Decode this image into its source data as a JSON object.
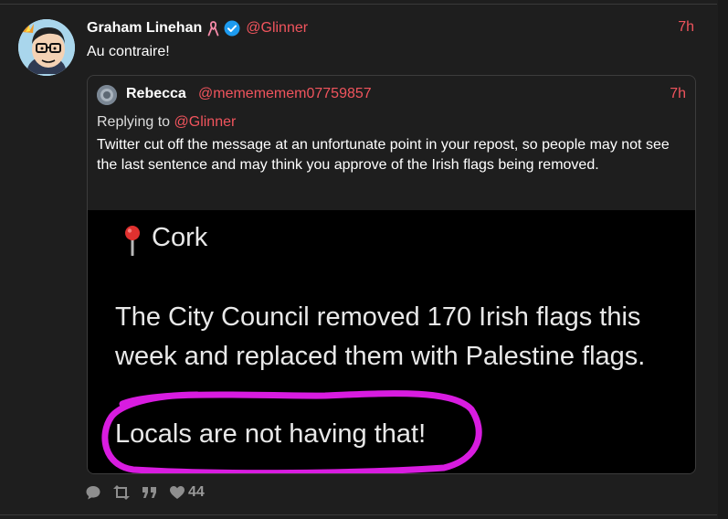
{
  "tweet": {
    "author_name": "Graham Linehan",
    "author_handle": "@Glinner",
    "timestamp": "7h",
    "text": "Au contraire!",
    "icons": [
      "ribbon-icon",
      "verified-icon"
    ]
  },
  "quote": {
    "author_name": "Rebecca",
    "author_handle": "@memememem07759857",
    "timestamp": "7h",
    "replying_prefix": "Replying to",
    "replying_handle": "@Glinner",
    "body": "Twitter cut off the message at an unfortunate point in your repost, so people may not see the last sentence and may think you approve of the Irish flags being removed.",
    "image": {
      "location": "Cork",
      "line1": "The City Council removed 170 Irish flags this",
      "line2": "week and replaced them with Palestine flags.",
      "line3": "Locals are not having that!",
      "highlight_color": "#d81ce0"
    }
  },
  "actions": {
    "likes": "44",
    "icons": [
      "reply-icon",
      "retweet-icon",
      "quote-icon",
      "heart-icon"
    ]
  },
  "colors": {
    "background": "#1e1e1e",
    "accent": "#f0545d",
    "text": "#ffffff",
    "muted": "#9a9a9a"
  }
}
